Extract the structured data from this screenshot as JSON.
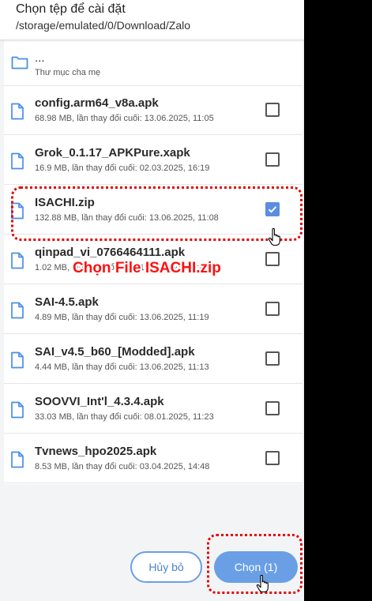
{
  "header": {
    "title": "Chọn tệp để cài đặt",
    "path": "/storage/emulated/0/Download/Zalo"
  },
  "parent_item": {
    "name": "...",
    "meta": "Thư mục cha mẹ",
    "icon": "folder-icon"
  },
  "files": [
    {
      "name": "config.arm64_v8a.apk",
      "meta": "68.98 MB, lần thay đổi cuối: 13.06.2025, 11:05",
      "checked": false
    },
    {
      "name": "Grok_0.1.17_APKPure.xapk",
      "meta": "16.9 MB, lần thay đổi cuối: 02.03.2025, 16:19",
      "checked": false
    },
    {
      "name": "ISACHI.zip",
      "meta": "132.88 MB, lần thay đổi cuối: 13.06.2025, 11:08",
      "checked": true
    },
    {
      "name": "qinpad_vi_0766464111.apk",
      "meta": "1.02 MB, lần thay đổi cuối: 13.06.2025, 11:09",
      "checked": false
    },
    {
      "name": "SAI-4.5.apk",
      "meta": "4.89 MB, lần thay đổi cuối: 13.06.2025, 11:19",
      "checked": false
    },
    {
      "name": "SAI_v4.5_b60_[Modded].apk",
      "meta": "4.44 MB, lần thay đổi cuối: 13.06.2025, 11:13",
      "checked": false
    },
    {
      "name": "SOOVVI_Int'l_4.3.4.apk",
      "meta": "33.03 MB, lần thay đổi cuối: 08.01.2025, 11:23",
      "checked": false
    },
    {
      "name": "Tvnews_hpo2025.apk",
      "meta": "8.53 MB, lần thay đổi cuối: 03.04.2025, 14:48",
      "checked": false
    }
  ],
  "footer": {
    "cancel_label": "Hủy bỏ",
    "choose_label": "Chọn (1)"
  },
  "annotation": {
    "label": "Chọn File ISACHI.zip"
  },
  "colors": {
    "accent": "#6a9fe6",
    "annotation": "#e60000",
    "folder": "#4a8ee8"
  }
}
